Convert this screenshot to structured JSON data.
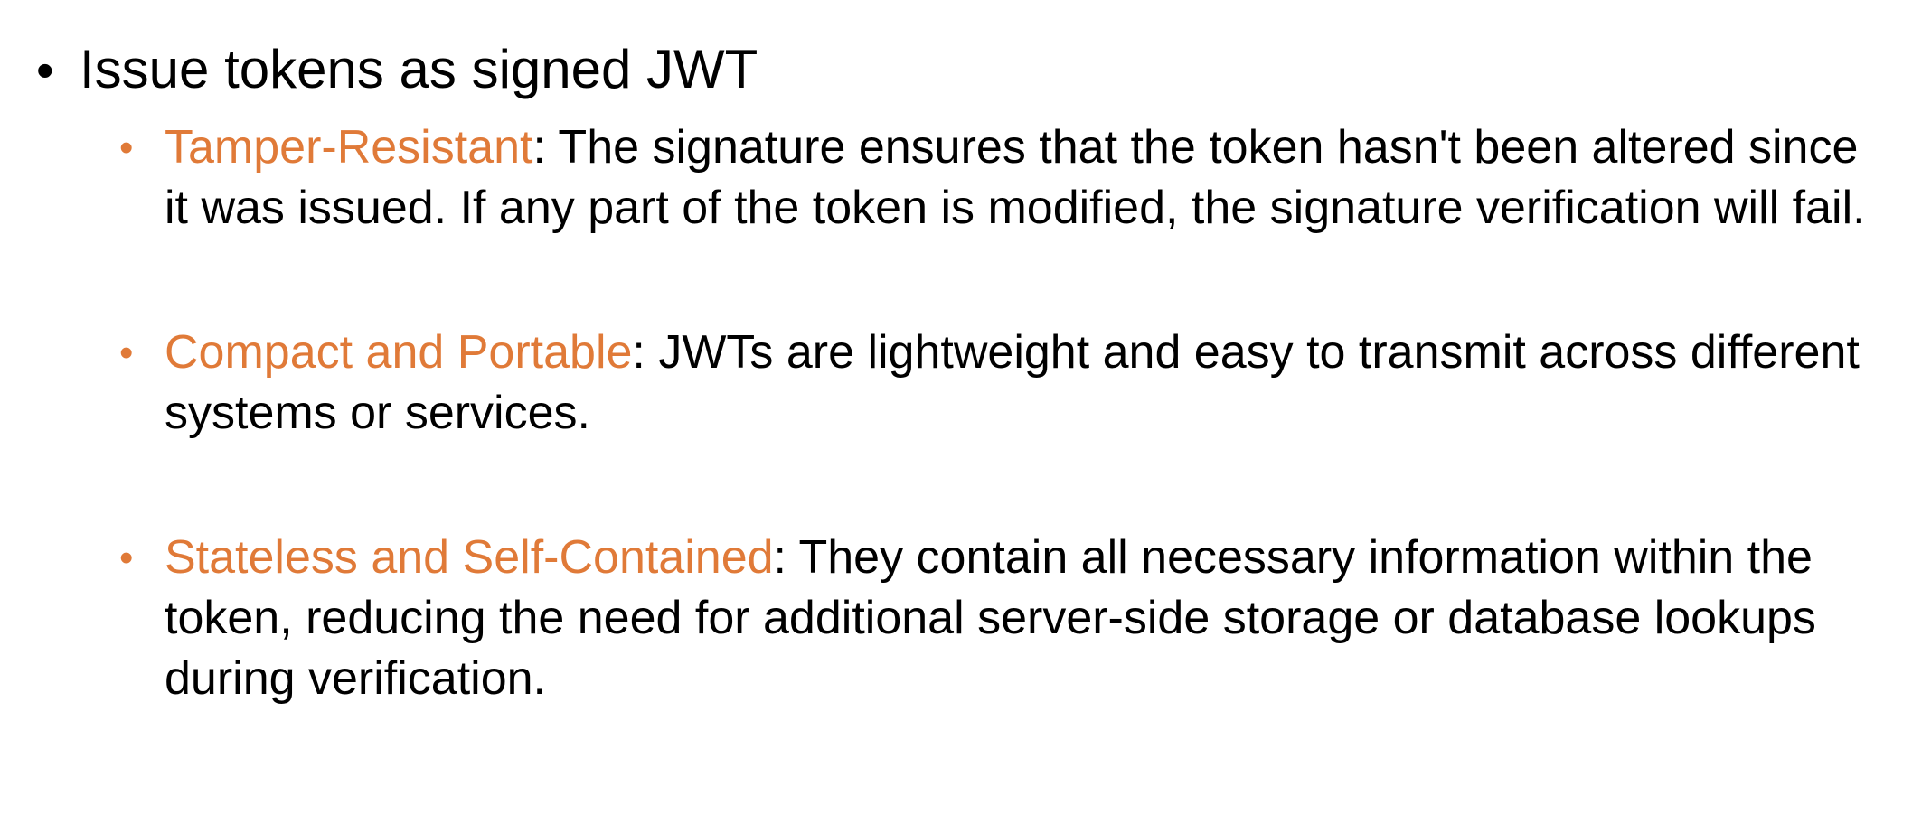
{
  "colors": {
    "accent": "#E07A38",
    "text": "#000000",
    "background": "#FFFFFF"
  },
  "main_bullet": {
    "symbol": "•",
    "text": "Issue tokens as signed JWT"
  },
  "sub_bullets": [
    {
      "symbol": "•",
      "term": "Tamper-Resistant",
      "description": ": The signature ensures that the token hasn't been altered since it was issued. If any part of the token is modified, the signature verification will fail."
    },
    {
      "symbol": "•",
      "term": "Compact and Portable",
      "description": ": JWTs are lightweight and easy to transmit across different systems or services."
    },
    {
      "symbol": "•",
      "term": "Stateless and Self-Contained",
      "description": ": They contain all necessary information within the token, reducing the need for additional server-side storage or database lookups during verification."
    }
  ]
}
